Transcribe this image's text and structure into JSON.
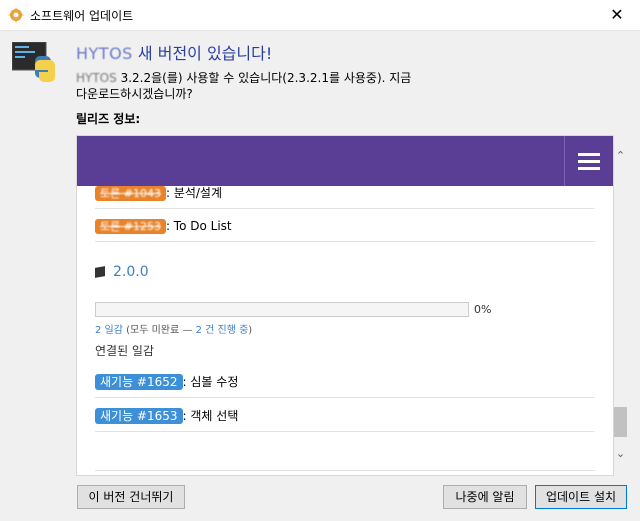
{
  "window": {
    "title": "소프트웨어 업데이트",
    "close_glyph": "✕"
  },
  "header": {
    "app_name": "HYTOS",
    "headline_suffix": " 새 버전이 있습니다!",
    "desc_app": "HYTOS",
    "desc_text": " 3.2.2을(를) 사용할 수 있습니다(2.3.2.1를 사용중). 지금 다운로드하시겠습니까?"
  },
  "release_label": "릴리즈 정보:",
  "notes": {
    "item1_tag": "토론 #1043",
    "item1_text": ": 분석/설계",
    "item2_tag": "토론 #1253",
    "item2_text": ": To Do List",
    "version": "2.0.0",
    "progress": {
      "percent": 0,
      "label": "0%"
    },
    "stats_open": "2 일감",
    "stats_mid": "  (모두 미완료 — ",
    "stats_progress": "2 건 진행 중",
    "stats_end": ")",
    "linked_title": "연결된 일감",
    "feature1_tag": "새기능 #1652",
    "feature1_text": ": 심볼 수정",
    "feature2_tag": "새기능 #1653",
    "feature2_text": ": 객체 선택"
  },
  "scrollbar": {
    "up": "⌃",
    "down": "⌄"
  },
  "buttons": {
    "skip": "이 버전 건너뛰기",
    "later": "나중에 알림",
    "install": "업데이트 설치"
  },
  "colors": {
    "purple": "#5a3e96",
    "orange_tag": "#e8832a",
    "blue_tag": "#3d8fd8",
    "link": "#3d7fc8"
  }
}
